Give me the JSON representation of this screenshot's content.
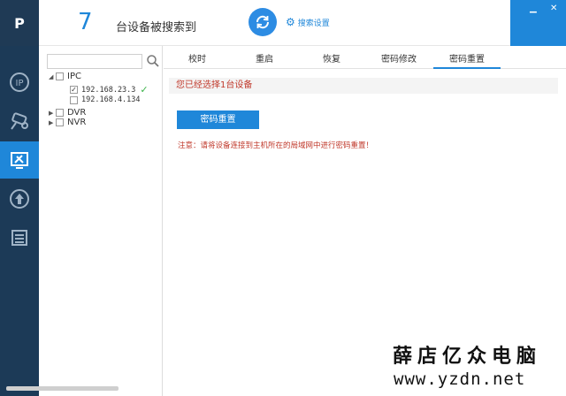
{
  "app": {
    "logo_text": "P"
  },
  "colors": {
    "accent": "#1f87d9",
    "nav_bg": "#1c3a57",
    "warning_text": "#c0392b",
    "ok": "#3cb34a"
  },
  "header": {
    "device_count": "7",
    "count_label": "台设备被搜索到",
    "search_settings_label": "搜索设置"
  },
  "window_controls": [
    "minimize-icon",
    "close-icon"
  ],
  "nav": {
    "items": [
      {
        "icon": "ip-search-icon",
        "active": false
      },
      {
        "icon": "camera-icon",
        "active": false
      },
      {
        "icon": "tools-icon",
        "active": true
      },
      {
        "icon": "upgrade-icon",
        "active": false
      },
      {
        "icon": "list-icon",
        "active": false
      }
    ]
  },
  "tree": {
    "search_placeholder": "",
    "groups": [
      {
        "label": "IPC",
        "expanded": true,
        "children": [
          {
            "ip": "192.168.23.3",
            "checked": true,
            "ok": true
          },
          {
            "ip": "192.168.4.134",
            "checked": false,
            "ok": false
          }
        ]
      },
      {
        "label": "DVR",
        "expanded": false
      },
      {
        "label": "NVR",
        "expanded": false
      }
    ]
  },
  "tabs": [
    {
      "label": "校时",
      "active": false
    },
    {
      "label": "重启",
      "active": false
    },
    {
      "label": "恢复",
      "active": false
    },
    {
      "label": "密码修改",
      "active": false
    },
    {
      "label": "密码重置",
      "active": true
    }
  ],
  "main": {
    "selected_message": "您已经选择1台设备",
    "reset_button_label": "密码重置",
    "note": "注意：请将设备连接到主机所在的局域网中进行密码重置！"
  },
  "watermark": {
    "title": "薛店亿众电脑",
    "url": "www.yzdn.net"
  }
}
